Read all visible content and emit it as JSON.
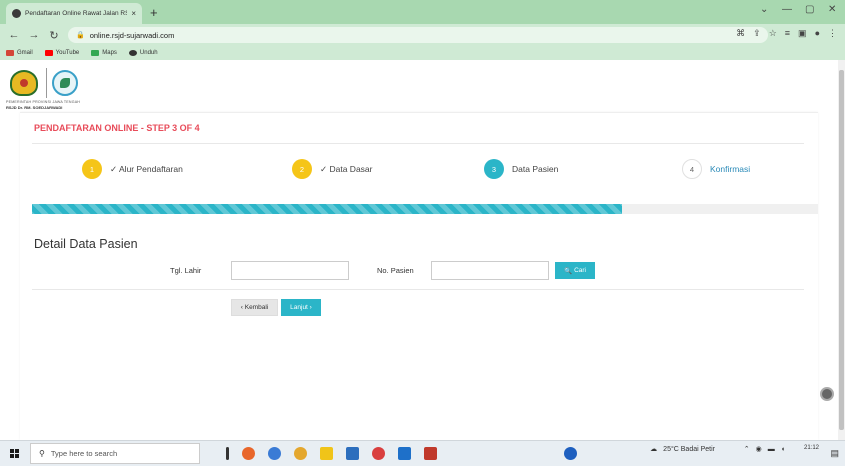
{
  "browser": {
    "tab_title": "Pendaftaran Online Rawat Jalan RSJD D",
    "tab_close": "×",
    "new_tab": "+",
    "url": "online.rsjd-sujarwadi.com",
    "bookmarks": [
      {
        "label": "Gmail",
        "color": "#d44638"
      },
      {
        "label": "YouTube",
        "color": "#ff0000"
      },
      {
        "label": "Maps",
        "color": "#34a853"
      },
      {
        "label": "Unduh",
        "color": "#333333"
      }
    ]
  },
  "header": {
    "logo_text_line1": "PEMERINTAH PROVINSI JAWA TENGAH",
    "logo_text_line2": "RSJD Dr. RM. SOEDJARWADI"
  },
  "wizard": {
    "title": "PENDAFTARAN ONLINE - STEP 3 OF 4",
    "progress_percent": 75,
    "steps": [
      {
        "num": "1",
        "label": "✓ Alur Pendaftaran",
        "color": "#f5c518",
        "state": "done"
      },
      {
        "num": "2",
        "label": "✓ Data Dasar",
        "color": "#f5c518",
        "state": "done"
      },
      {
        "num": "3",
        "label": "Data Pasien",
        "color": "#2bb5c8",
        "state": "active"
      },
      {
        "num": "4",
        "label": "Konfirmasi",
        "color": "#d8d8d8",
        "state": "pending"
      }
    ]
  },
  "form": {
    "section_title": "Detail Data Pasien",
    "tgl_lahir_label": "Tgl. Lahir",
    "tgl_lahir_value": "",
    "no_pasien_label": "No. Pasien",
    "no_pasien_value": "",
    "cari_label": "Cari",
    "back_label": "‹ Kembali",
    "next_label": "Lanjut ›"
  },
  "taskbar": {
    "search_placeholder": "Type here to search",
    "weather": "25°C  Badai Petir",
    "time": "21:12"
  },
  "colors": {
    "accent": "#2bb5c8",
    "title_red": "#e84c5a",
    "step_done": "#f5c518"
  }
}
